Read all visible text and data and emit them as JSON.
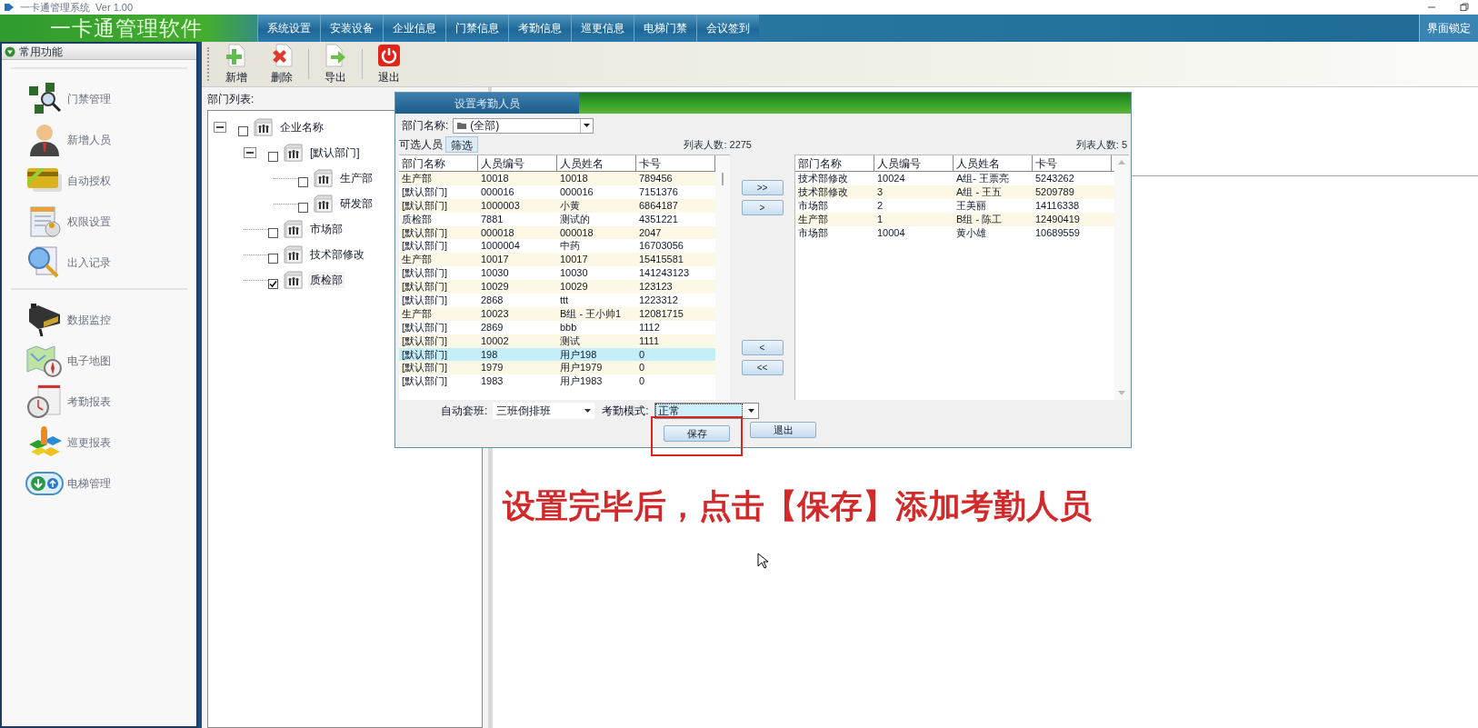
{
  "window": {
    "title": "一卡通管理系统  Ver 1.00"
  },
  "app_title": "一卡通管理软件",
  "menu": [
    {
      "label": "系统设置"
    },
    {
      "label": "安装设备"
    },
    {
      "label": "企业信息"
    },
    {
      "label": "门禁信息"
    },
    {
      "label": "考勤信息"
    },
    {
      "label": "巡更信息"
    },
    {
      "label": "电梯门禁"
    },
    {
      "label": "会议签到"
    }
  ],
  "lock_button": "界面锁定",
  "sidebar": {
    "header": "常用功能",
    "expanded": true,
    "groups": [
      [
        {
          "label": "门禁管理",
          "kind": "chips"
        },
        {
          "label": "新增人员",
          "kind": "person"
        },
        {
          "label": "自动授权",
          "kind": "cards"
        },
        {
          "label": "权限设置",
          "kind": "document"
        },
        {
          "label": "出入记录",
          "kind": "magnifier"
        }
      ],
      [
        {
          "label": "数据监控",
          "kind": "camera"
        },
        {
          "label": "电子地图",
          "kind": "map"
        },
        {
          "label": "考勤报表",
          "kind": "stopwatch"
        },
        {
          "label": "巡更报表",
          "kind": "blocks"
        },
        {
          "label": "电梯管理",
          "kind": "elevator"
        }
      ]
    ]
  },
  "toolbar": [
    {
      "label": "新增",
      "kind": "add"
    },
    {
      "label": "删除",
      "kind": "delete"
    },
    {
      "label": "导出",
      "kind": "export"
    },
    {
      "label": "退出",
      "kind": "exit"
    }
  ],
  "dept_tree": {
    "label": "部门列表:",
    "nodes": [
      {
        "label": "企业名称",
        "checked": false,
        "expanded": true,
        "children": [
          {
            "label": "[默认部门]",
            "checked": false,
            "expanded": true,
            "children": [
              {
                "label": "生产部",
                "checked": false
              },
              {
                "label": "研发部",
                "checked": false
              }
            ]
          },
          {
            "label": "市场部",
            "checked": false
          },
          {
            "label": "技术部修改",
            "checked": false
          },
          {
            "label": "质检部",
            "checked": true
          }
        ]
      }
    ]
  },
  "dialog": {
    "title": "设置考勤人员",
    "dept_label": "部门名称:",
    "dept_value": "(全部)",
    "available_label": "可选人员",
    "filter_button": "筛选",
    "left_count": "列表人数: 2275",
    "right_count": "列表人数: 5",
    "left_columns": [
      "部门名称",
      "人员编号",
      "人员姓名",
      "卡号"
    ],
    "right_columns": [
      "部门名称",
      "人员编号",
      "人员姓名",
      "卡号"
    ],
    "left_rows": [
      {
        "cells": [
          "生产部",
          "10018",
          "10018",
          "789456"
        ],
        "selected": false
      },
      {
        "cells": [
          "[默认部门]",
          "000016",
          "000016",
          "7151376"
        ],
        "selected": false
      },
      {
        "cells": [
          "[默认部门]",
          "1000003",
          "小黄",
          "6864187"
        ],
        "selected": false
      },
      {
        "cells": [
          "质检部",
          "7881",
          "测试的",
          "4351221"
        ],
        "selected": false
      },
      {
        "cells": [
          "[默认部门]",
          "000018",
          "000018",
          "2047"
        ],
        "selected": false
      },
      {
        "cells": [
          "[默认部门]",
          "1000004",
          "中药",
          "16703056"
        ],
        "selected": false
      },
      {
        "cells": [
          "生产部",
          "10017",
          "10017",
          "15415581"
        ],
        "selected": false
      },
      {
        "cells": [
          "[默认部门]",
          "10030",
          "10030",
          "141243123"
        ],
        "selected": false
      },
      {
        "cells": [
          "[默认部门]",
          "10029",
          "10029",
          "123123"
        ],
        "selected": false
      },
      {
        "cells": [
          "[默认部门]",
          "2868",
          "ttt",
          "1223312"
        ],
        "selected": false
      },
      {
        "cells": [
          "生产部",
          "10023",
          "B组 - 王小帅1",
          "12081715"
        ],
        "selected": false
      },
      {
        "cells": [
          "[默认部门]",
          "2869",
          "bbb",
          "1112"
        ],
        "selected": false
      },
      {
        "cells": [
          "[默认部门]",
          "10002",
          "测试",
          "1111"
        ],
        "selected": false
      },
      {
        "cells": [
          "[默认部门]",
          "198",
          "用户198",
          "0"
        ],
        "selected": true
      },
      {
        "cells": [
          "[默认部门]",
          "1979",
          "用户1979",
          "0"
        ],
        "selected": false
      },
      {
        "cells": [
          "[默认部门]",
          "1983",
          "用户1983",
          "0"
        ],
        "selected": false
      }
    ],
    "transfer_buttons": [
      ">>",
      ">",
      "<",
      "<<"
    ],
    "right_rows": [
      {
        "cells": [
          "技术部修改",
          "10024",
          "A组- 王票亮",
          "5243262"
        ],
        "selected": false
      },
      {
        "cells": [
          "技术部修改",
          "3",
          "A组 - 王五",
          "5209789"
        ],
        "selected": false
      },
      {
        "cells": [
          "市场部",
          "2",
          "王美丽",
          "14116338"
        ],
        "selected": false
      },
      {
        "cells": [
          "生产部",
          "1",
          "B组 - 陈工",
          "12490419"
        ],
        "selected": false
      },
      {
        "cells": [
          "市场部",
          "10004",
          "黄小雄",
          "10689559"
        ],
        "selected": false
      }
    ],
    "shift_label": "自动套班:",
    "shift_value": "三班倒排班",
    "mode_label": "考勤模式:",
    "mode_value": "正常",
    "buttons": [
      {
        "label": "保存",
        "highlighted": true
      },
      {
        "label": "退出",
        "highlighted": false
      }
    ]
  },
  "caption": "设置完毕后，点击【保存】添加考勤人员"
}
